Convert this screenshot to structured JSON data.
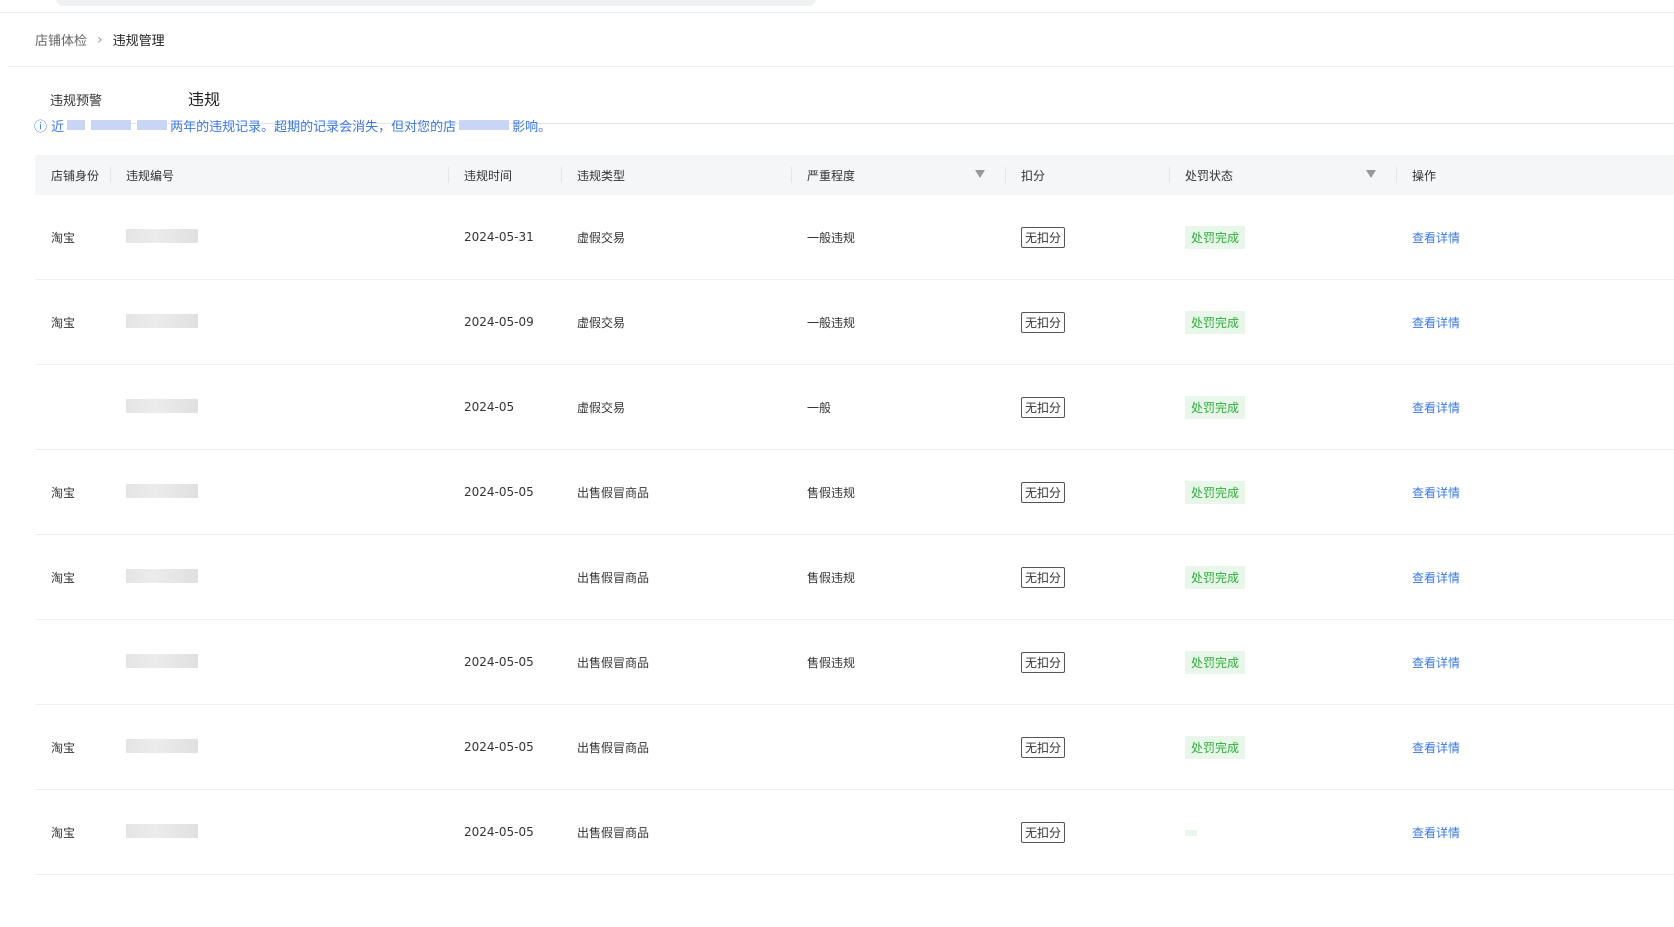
{
  "breadcrumb": {
    "parent": "店铺体检",
    "separator": "›",
    "current": "违规管理"
  },
  "tabs": [
    {
      "label": "违规预警"
    },
    {
      "label": "违规"
    }
  ],
  "notice": {
    "prefix": "ⓘ 近",
    "middle": "两年的违规记录。超期的记录会消失，但对您的店",
    "suffix": "影响。"
  },
  "table": {
    "columns": [
      "店铺身份",
      "违规编号",
      "违规时间",
      "违规类型",
      "严重程度",
      "扣分",
      "处罚状态",
      "操作"
    ],
    "rows": [
      {
        "shop": "淘宝",
        "date": "2024-05-31",
        "type": "虚假交易",
        "severity": "一般违规",
        "deduct": "无扣分",
        "status": "处罚完成",
        "action": "查看详情"
      },
      {
        "shop": "淘宝",
        "date": "2024-05-09",
        "type": "虚假交易",
        "severity": "一般违规",
        "deduct": "无扣分",
        "status": "处罚完成",
        "action": "查看详情"
      },
      {
        "shop": "",
        "date": "2024-05",
        "type": "虚假交易",
        "severity": "一般",
        "deduct": "无扣分",
        "status": "处罚完成",
        "action": "查看详情"
      },
      {
        "shop": "淘宝",
        "date": "2024-05-05",
        "type": "出售假冒商品",
        "severity": "售假违规",
        "deduct": "无扣分",
        "status": "处罚完成",
        "action": "查看详情"
      },
      {
        "shop": "淘宝",
        "date": "",
        "type": "出售假冒商品",
        "severity": "售假违规",
        "deduct": "无扣分",
        "status": "处罚完成",
        "action": "查看详情"
      },
      {
        "shop": "",
        "date": "2024-05-05",
        "type": "出售假冒商品",
        "severity": "售假违规",
        "deduct": "无扣分",
        "status": "处罚完成",
        "action": "查看详情"
      },
      {
        "shop": "淘宝",
        "date": "2024-05-05",
        "type": "出售假冒商品",
        "severity": "",
        "deduct": "无扣分",
        "status": "处罚完成",
        "action": "查看详情"
      },
      {
        "shop": "淘宝",
        "date": "2024-05-05",
        "type": "出售假冒商品",
        "severity": "",
        "deduct": "无扣分",
        "status": "",
        "action": "查看详情"
      }
    ]
  },
  "colors": {
    "link": "#3b78e7",
    "status_text": "#2fae3a",
    "status_bg": "#e8f7ea",
    "header_bg": "#f5f6f8"
  }
}
